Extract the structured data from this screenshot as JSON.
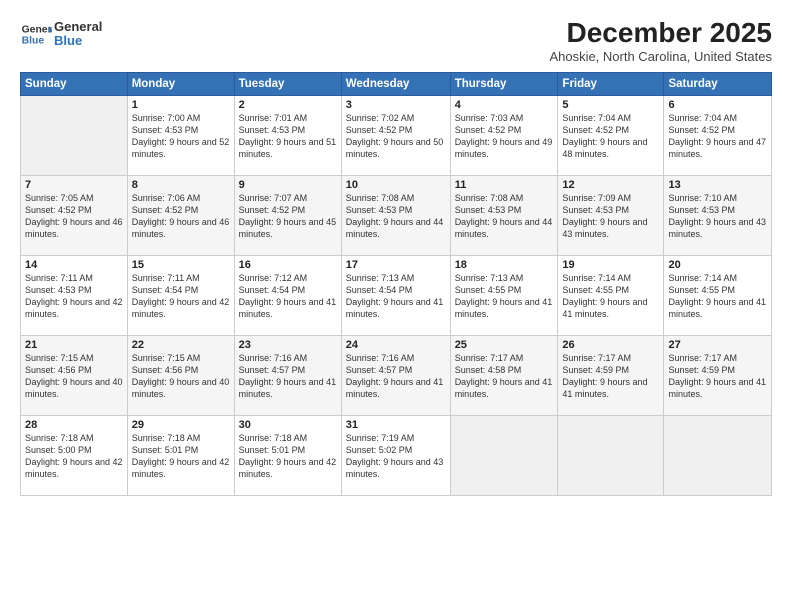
{
  "header": {
    "logo_line1": "General",
    "logo_line2": "Blue",
    "month": "December 2025",
    "location": "Ahoskie, North Carolina, United States"
  },
  "weekdays": [
    "Sunday",
    "Monday",
    "Tuesday",
    "Wednesday",
    "Thursday",
    "Friday",
    "Saturday"
  ],
  "weeks": [
    [
      {
        "day": "",
        "sunrise": "",
        "sunset": "",
        "daylight": ""
      },
      {
        "day": "1",
        "sunrise": "Sunrise: 7:00 AM",
        "sunset": "Sunset: 4:53 PM",
        "daylight": "Daylight: 9 hours and 52 minutes."
      },
      {
        "day": "2",
        "sunrise": "Sunrise: 7:01 AM",
        "sunset": "Sunset: 4:53 PM",
        "daylight": "Daylight: 9 hours and 51 minutes."
      },
      {
        "day": "3",
        "sunrise": "Sunrise: 7:02 AM",
        "sunset": "Sunset: 4:52 PM",
        "daylight": "Daylight: 9 hours and 50 minutes."
      },
      {
        "day": "4",
        "sunrise": "Sunrise: 7:03 AM",
        "sunset": "Sunset: 4:52 PM",
        "daylight": "Daylight: 9 hours and 49 minutes."
      },
      {
        "day": "5",
        "sunrise": "Sunrise: 7:04 AM",
        "sunset": "Sunset: 4:52 PM",
        "daylight": "Daylight: 9 hours and 48 minutes."
      },
      {
        "day": "6",
        "sunrise": "Sunrise: 7:04 AM",
        "sunset": "Sunset: 4:52 PM",
        "daylight": "Daylight: 9 hours and 47 minutes."
      }
    ],
    [
      {
        "day": "7",
        "sunrise": "Sunrise: 7:05 AM",
        "sunset": "Sunset: 4:52 PM",
        "daylight": "Daylight: 9 hours and 46 minutes."
      },
      {
        "day": "8",
        "sunrise": "Sunrise: 7:06 AM",
        "sunset": "Sunset: 4:52 PM",
        "daylight": "Daylight: 9 hours and 46 minutes."
      },
      {
        "day": "9",
        "sunrise": "Sunrise: 7:07 AM",
        "sunset": "Sunset: 4:52 PM",
        "daylight": "Daylight: 9 hours and 45 minutes."
      },
      {
        "day": "10",
        "sunrise": "Sunrise: 7:08 AM",
        "sunset": "Sunset: 4:53 PM",
        "daylight": "Daylight: 9 hours and 44 minutes."
      },
      {
        "day": "11",
        "sunrise": "Sunrise: 7:08 AM",
        "sunset": "Sunset: 4:53 PM",
        "daylight": "Daylight: 9 hours and 44 minutes."
      },
      {
        "day": "12",
        "sunrise": "Sunrise: 7:09 AM",
        "sunset": "Sunset: 4:53 PM",
        "daylight": "Daylight: 9 hours and 43 minutes."
      },
      {
        "day": "13",
        "sunrise": "Sunrise: 7:10 AM",
        "sunset": "Sunset: 4:53 PM",
        "daylight": "Daylight: 9 hours and 43 minutes."
      }
    ],
    [
      {
        "day": "14",
        "sunrise": "Sunrise: 7:11 AM",
        "sunset": "Sunset: 4:53 PM",
        "daylight": "Daylight: 9 hours and 42 minutes."
      },
      {
        "day": "15",
        "sunrise": "Sunrise: 7:11 AM",
        "sunset": "Sunset: 4:54 PM",
        "daylight": "Daylight: 9 hours and 42 minutes."
      },
      {
        "day": "16",
        "sunrise": "Sunrise: 7:12 AM",
        "sunset": "Sunset: 4:54 PM",
        "daylight": "Daylight: 9 hours and 41 minutes."
      },
      {
        "day": "17",
        "sunrise": "Sunrise: 7:13 AM",
        "sunset": "Sunset: 4:54 PM",
        "daylight": "Daylight: 9 hours and 41 minutes."
      },
      {
        "day": "18",
        "sunrise": "Sunrise: 7:13 AM",
        "sunset": "Sunset: 4:55 PM",
        "daylight": "Daylight: 9 hours and 41 minutes."
      },
      {
        "day": "19",
        "sunrise": "Sunrise: 7:14 AM",
        "sunset": "Sunset: 4:55 PM",
        "daylight": "Daylight: 9 hours and 41 minutes."
      },
      {
        "day": "20",
        "sunrise": "Sunrise: 7:14 AM",
        "sunset": "Sunset: 4:55 PM",
        "daylight": "Daylight: 9 hours and 41 minutes."
      }
    ],
    [
      {
        "day": "21",
        "sunrise": "Sunrise: 7:15 AM",
        "sunset": "Sunset: 4:56 PM",
        "daylight": "Daylight: 9 hours and 40 minutes."
      },
      {
        "day": "22",
        "sunrise": "Sunrise: 7:15 AM",
        "sunset": "Sunset: 4:56 PM",
        "daylight": "Daylight: 9 hours and 40 minutes."
      },
      {
        "day": "23",
        "sunrise": "Sunrise: 7:16 AM",
        "sunset": "Sunset: 4:57 PM",
        "daylight": "Daylight: 9 hours and 41 minutes."
      },
      {
        "day": "24",
        "sunrise": "Sunrise: 7:16 AM",
        "sunset": "Sunset: 4:57 PM",
        "daylight": "Daylight: 9 hours and 41 minutes."
      },
      {
        "day": "25",
        "sunrise": "Sunrise: 7:17 AM",
        "sunset": "Sunset: 4:58 PM",
        "daylight": "Daylight: 9 hours and 41 minutes."
      },
      {
        "day": "26",
        "sunrise": "Sunrise: 7:17 AM",
        "sunset": "Sunset: 4:59 PM",
        "daylight": "Daylight: 9 hours and 41 minutes."
      },
      {
        "day": "27",
        "sunrise": "Sunrise: 7:17 AM",
        "sunset": "Sunset: 4:59 PM",
        "daylight": "Daylight: 9 hours and 41 minutes."
      }
    ],
    [
      {
        "day": "28",
        "sunrise": "Sunrise: 7:18 AM",
        "sunset": "Sunset: 5:00 PM",
        "daylight": "Daylight: 9 hours and 42 minutes."
      },
      {
        "day": "29",
        "sunrise": "Sunrise: 7:18 AM",
        "sunset": "Sunset: 5:01 PM",
        "daylight": "Daylight: 9 hours and 42 minutes."
      },
      {
        "day": "30",
        "sunrise": "Sunrise: 7:18 AM",
        "sunset": "Sunset: 5:01 PM",
        "daylight": "Daylight: 9 hours and 42 minutes."
      },
      {
        "day": "31",
        "sunrise": "Sunrise: 7:19 AM",
        "sunset": "Sunset: 5:02 PM",
        "daylight": "Daylight: 9 hours and 43 minutes."
      },
      {
        "day": "",
        "sunrise": "",
        "sunset": "",
        "daylight": ""
      },
      {
        "day": "",
        "sunrise": "",
        "sunset": "",
        "daylight": ""
      },
      {
        "day": "",
        "sunrise": "",
        "sunset": "",
        "daylight": ""
      }
    ]
  ]
}
